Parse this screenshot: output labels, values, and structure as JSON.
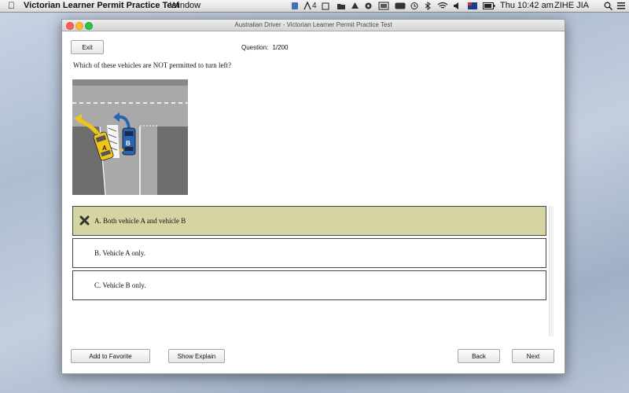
{
  "menubar": {
    "apple_icon": "apple-icon",
    "app_name": "Victorian Learner Permit Practice Test",
    "window_menu": "Window",
    "status_badge": "4",
    "clock": "Thu 10:42 am",
    "user": "ZIHE JIA"
  },
  "window": {
    "title": "Australian Driver - Victorian Learner Permit Practice Test"
  },
  "toolbar": {
    "exit_label": "Exit",
    "counter_label": "Question:",
    "counter_value": "1/200"
  },
  "question": {
    "text": "Which of these vehicles are NOT permitted to turn left?",
    "figure_labels": [
      "A",
      "B"
    ]
  },
  "options": [
    {
      "label": "A. Both vehicle A and vehicle B",
      "selected": true,
      "marked_wrong": true
    },
    {
      "label": "B. Vehicle A only.",
      "selected": false,
      "marked_wrong": false
    },
    {
      "label": "C. Vehicle B only.",
      "selected": false,
      "marked_wrong": false
    }
  ],
  "footer": {
    "favorite_label": "Add to Favorite",
    "explain_label": "Show Explain",
    "back_label": "Back",
    "next_label": "Next"
  },
  "colors": {
    "selected_option_bg": "#d5d4a2",
    "vehicle_a": "#f0c419",
    "vehicle_b": "#2a63b0",
    "road": "#a8a8a8"
  }
}
